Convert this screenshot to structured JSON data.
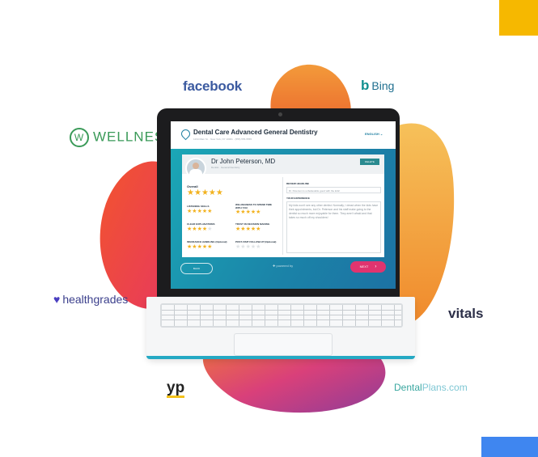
{
  "colors": {
    "accent_teal": "#1b83a8",
    "accent_pink": "#e0346f",
    "star_gold": "#f2b21f",
    "corner_yellow": "#f6b800",
    "corner_blue": "#3f86f0"
  },
  "logos": {
    "facebook": "facebook",
    "bing": "Bing",
    "wellness": "WELLNESS",
    "healthgrades": "healthgrades",
    "vitals": "vitals",
    "yp": "yp",
    "dentalplans_a": "Dental",
    "dentalplans_b": "Plans.com"
  },
  "app": {
    "clinic_name": "Dental Care Advanced General Dentistry",
    "address": "1234 Main St. · New York, NY 10001 · (555) 555-5555",
    "language": "ENGLISH",
    "doctor_name": "Dr John Peterson, MD",
    "doctor_subtitle": "Dentist · General Dentistry",
    "delete_label": "DELETE",
    "overall_label": "Overall",
    "overall_rating": 5,
    "ratings": [
      {
        "label": "LISTENING SKILLS",
        "value": 5
      },
      {
        "label": "WILLINGNESS TO SPEND TIME WITH YOU",
        "value": 5
      },
      {
        "label": "CLEAR EXPLANATIONS",
        "value": 4
      },
      {
        "label": "TRUST IN DECISION MAKING",
        "value": 5
      },
      {
        "label": "INSURANCE HANDLING (Optional)",
        "value": 5
      },
      {
        "label": "POST-VISIT FOLLOW-UP (Optional)",
        "value": 0
      }
    ],
    "review_headline_label": "REVIEW HEADLINE",
    "review_headline_value": "Dr. Peterson is unbelievable good with the kids!",
    "your_experience_label": "YOUR EXPERIENCE",
    "your_experience_value": "My kids won't see any other dentist. Normally, I dread when the kids have their appointments, but Dr. Peterson and his staff make going to the dentist so much more enjoyable for them. They aren't afraid and that takes so much off my shoulders!",
    "back_label": "BACK",
    "next_label": "NEXT",
    "powered_by": "powered by"
  }
}
